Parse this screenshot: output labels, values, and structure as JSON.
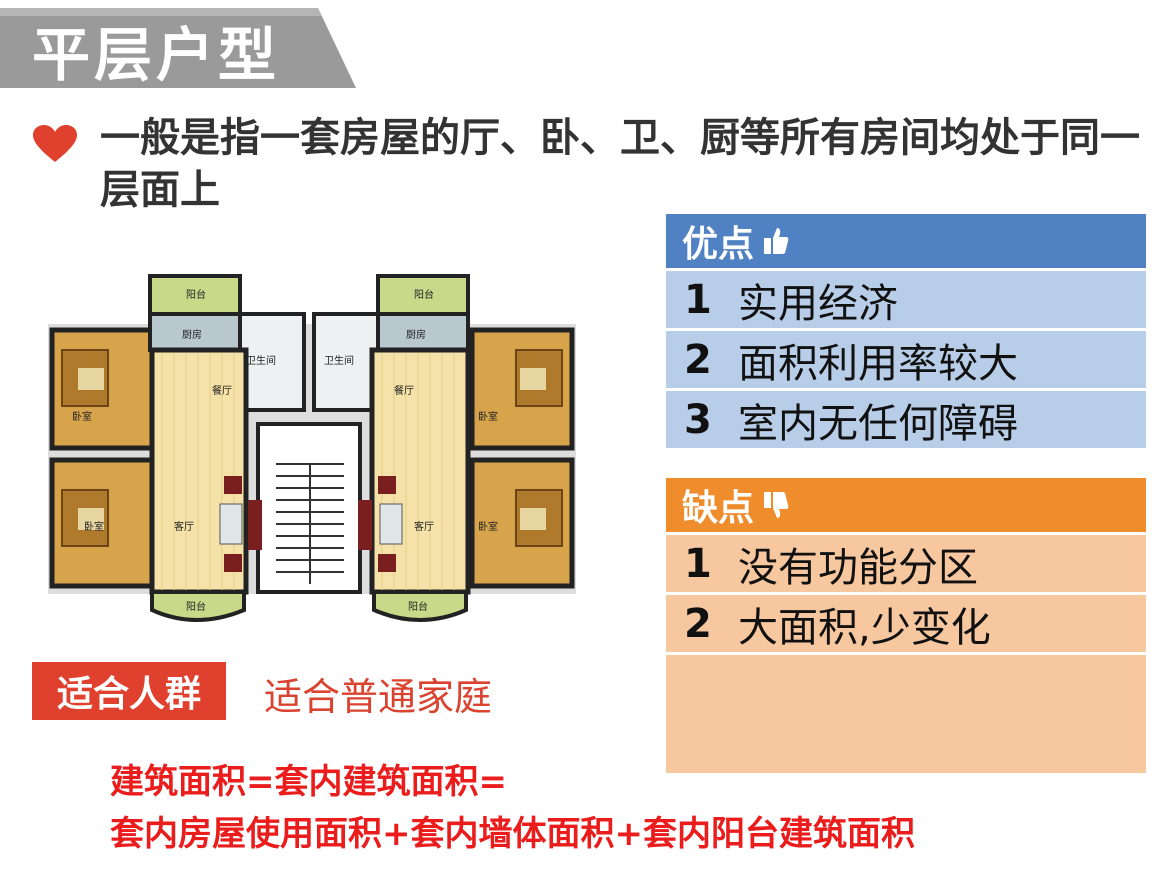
{
  "title": "平层户型",
  "intro": "一般是指一套房屋的厅、卧、卫、厨等所有房间均处于同一层面上",
  "floorplan": {
    "balcony_top_left": "阳台",
    "balcony_top_right": "阳台",
    "kitchen_left": "厨房",
    "kitchen_right": "厨房",
    "bath_left": "卫生间",
    "bath_right": "卫生间",
    "dining_left": "餐厅",
    "dining_right": "餐厅",
    "bedroom_tl": "卧室",
    "bedroom_tr": "卧室",
    "bedroom_bl": "卧室",
    "bedroom_br": "卧室",
    "living_left": "客厅",
    "living_right": "客厅",
    "balcony_bottom_left": "阳台",
    "balcony_bottom_right": "阳台"
  },
  "pros": {
    "title": "优点",
    "icon": "thumbs-up-icon",
    "items": [
      {
        "num": "1",
        "text": "实用经济"
      },
      {
        "num": "2",
        "text": "面积利用率较大"
      },
      {
        "num": "3",
        "text": "室内无任何障碍"
      }
    ]
  },
  "cons": {
    "title": "缺点",
    "icon": "thumbs-down-icon",
    "items": [
      {
        "num": "1",
        "text": "没有功能分区"
      },
      {
        "num": "2",
        "text": "大面积,少变化"
      }
    ]
  },
  "target": {
    "label": "适合人群",
    "value": "适合普通家庭"
  },
  "formula": {
    "line1": "建筑面积=套内建筑面积=",
    "line2": "套内房屋使用面积+套内墙体面积+套内阳台建筑面积"
  },
  "colors": {
    "title_bg": "#9a9a9a",
    "pros_head": "#4f81c3",
    "pros_row": "#b8cde8",
    "cons_head": "#ef8c2b",
    "cons_row": "#f7c8a0",
    "accent_red": "#e0402e",
    "formula_red": "#ea1c1c"
  }
}
